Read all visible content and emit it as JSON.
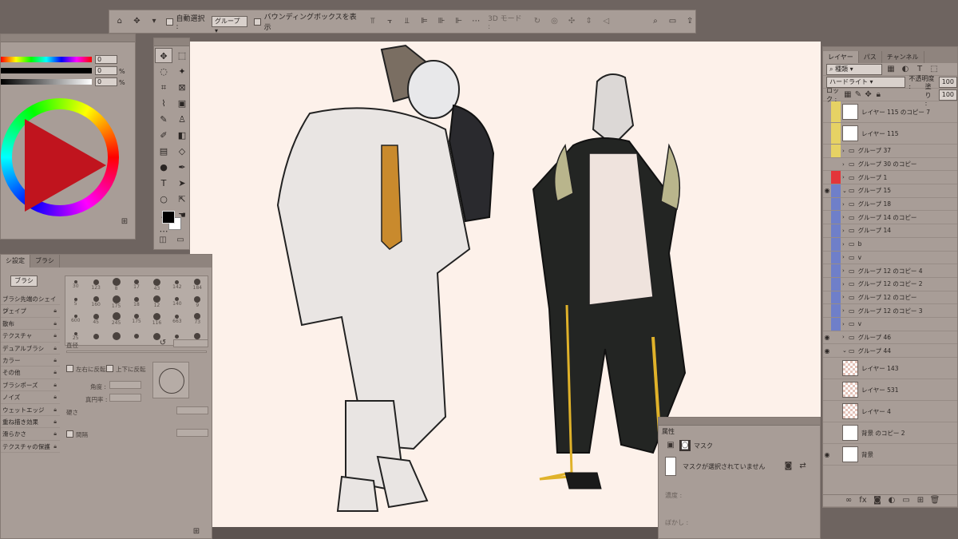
{
  "options_bar": {
    "auto_select_label": "自動選択 :",
    "auto_select_value": "グループ",
    "bbox_label": "バウンディングボックスを表示",
    "mode_3d_label": "3D モード :"
  },
  "color_panel": {
    "values": [
      "0",
      "0",
      "0"
    ],
    "pct": "%"
  },
  "brush_panel": {
    "tab_settings": "シ設定",
    "tab_brush": "ブラシ",
    "brush_button": "ブラシ",
    "items": [
      "ブラシ先端のシェイプ",
      "シェイプ",
      "散布",
      "テクスチャ",
      "デュアルブラシ",
      "カラー",
      "その他",
      "ブラシポーズ",
      "ノイズ",
      "ウェットエッジ",
      "重ね描き効果",
      "滑らかさ",
      "テクスチャの保護"
    ],
    "tip_sizes": [
      "30",
      "123",
      "8",
      "17",
      "43",
      "142",
      "184",
      "5",
      "160",
      "175",
      "18",
      "12",
      "140",
      "9",
      "600",
      "45",
      "245",
      "175",
      "116",
      "663",
      "73",
      "25"
    ],
    "diameter_label": "直径",
    "flip_x": "左右に反転",
    "flip_y": "上下に反転",
    "angle_label": "角度 :",
    "roundness_label": "真円率 :",
    "hardness_label": "硬さ",
    "spacing_label": "間隔"
  },
  "layers_panel": {
    "tabs": [
      "レイヤー",
      "パス",
      "チャンネル"
    ],
    "search_kind": "種類",
    "blend_mode": "ハードライト",
    "opacity_label": "不透明度 :",
    "opacity_value": "100",
    "lock_label": "ロック :",
    "fill_label": "塗り :",
    "fill_value": "100",
    "rows": [
      {
        "name": "レイヤー 115 のコピー 7",
        "tag": "#e6d264",
        "kind": "layer",
        "visible": false
      },
      {
        "name": "レイヤー 115",
        "tag": "#e6d264",
        "kind": "layer",
        "visible": false
      },
      {
        "name": "グループ 37",
        "tag": "#e6d264",
        "kind": "group",
        "visible": false
      },
      {
        "name": "グループ 30 のコピー",
        "tag": "",
        "kind": "group",
        "visible": false
      },
      {
        "name": "グループ 1",
        "tag": "#e3363a",
        "kind": "group",
        "visible": false
      },
      {
        "name": "グループ 15",
        "tag": "#6f7fc9",
        "kind": "group-open",
        "visible": true
      },
      {
        "name": "グループ 18",
        "tag": "#6f7fc9",
        "kind": "group",
        "visible": false
      },
      {
        "name": "グループ 14 のコピー",
        "tag": "#6f7fc9",
        "kind": "group",
        "visible": false
      },
      {
        "name": "グループ 14",
        "tag": "#6f7fc9",
        "kind": "group",
        "visible": false
      },
      {
        "name": "b",
        "tag": "#6f7fc9",
        "kind": "group",
        "visible": false
      },
      {
        "name": "v",
        "tag": "#6f7fc9",
        "kind": "group",
        "visible": false
      },
      {
        "name": "グループ 12 のコピー 4",
        "tag": "#6f7fc9",
        "kind": "group",
        "visible": false
      },
      {
        "name": "グループ 12 のコピー 2",
        "tag": "#6f7fc9",
        "kind": "group",
        "visible": false
      },
      {
        "name": "グループ 12 のコピー",
        "tag": "#6f7fc9",
        "kind": "group",
        "visible": false
      },
      {
        "name": "グループ 12 のコピー 3",
        "tag": "#6f7fc9",
        "kind": "group",
        "visible": false
      },
      {
        "name": "v",
        "tag": "#6f7fc9",
        "kind": "group",
        "visible": false
      },
      {
        "name": "グループ 46",
        "tag": "",
        "kind": "group",
        "visible": true
      },
      {
        "name": "グループ 44",
        "tag": "",
        "kind": "group-open",
        "visible": true
      },
      {
        "name": "レイヤー 143",
        "tag": "",
        "kind": "layer-checker",
        "visible": false
      },
      {
        "name": "レイヤー 531",
        "tag": "",
        "kind": "layer-checker",
        "visible": false
      },
      {
        "name": "レイヤー 4",
        "tag": "",
        "kind": "layer-checker",
        "visible": false
      },
      {
        "name": "背景 のコピー 2",
        "tag": "",
        "kind": "layer",
        "visible": false
      },
      {
        "name": "背景",
        "tag": "",
        "kind": "layer",
        "visible": true
      }
    ]
  },
  "properties_panel": {
    "title": "属性",
    "mask_label": "マスク",
    "no_mask_text": "マスクが選択されていません",
    "density_label": "濃度 :",
    "feather_label": "ぼかし :"
  }
}
